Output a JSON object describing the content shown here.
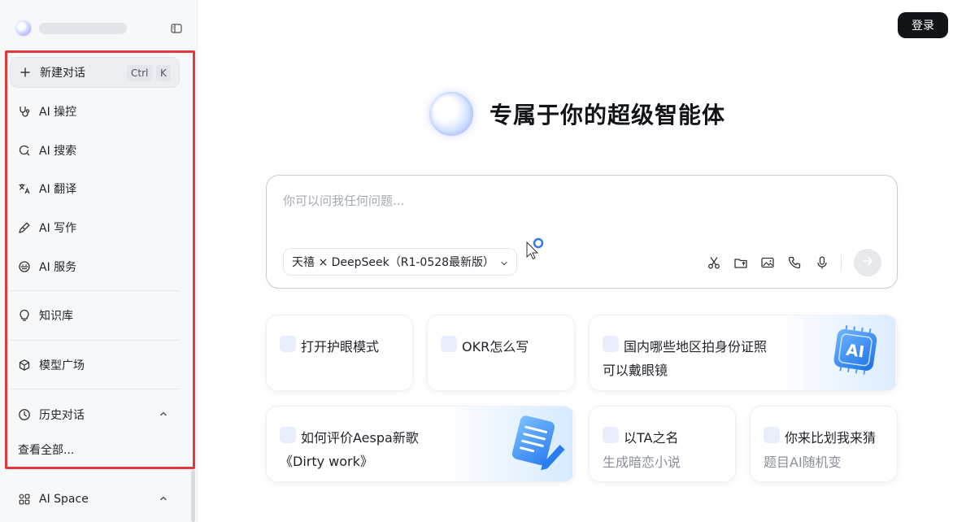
{
  "sidebar": {
    "collapse_icon": "sidebar-toggle-icon",
    "new_chat": {
      "label": "新建对话",
      "shortcut_ctrl": "Ctrl",
      "shortcut_key": "K"
    },
    "items": [
      {
        "label": "AI 操控",
        "icon": "stethoscope-icon"
      },
      {
        "label": "AI 搜索",
        "icon": "search-refresh-icon"
      },
      {
        "label": "AI 翻译",
        "icon": "translate-icon"
      },
      {
        "label": "AI 写作",
        "icon": "pen-icon"
      },
      {
        "label": "AI 服务",
        "icon": "service-icon"
      },
      {
        "label": "知识库",
        "icon": "lightbulb-icon"
      },
      {
        "label": "模型广场",
        "icon": "cube-icon"
      }
    ],
    "history": {
      "label": "历史对话",
      "see_all": "查看全部..."
    },
    "space": {
      "label": "AI Space"
    }
  },
  "header": {
    "login_label": "登录"
  },
  "hero": {
    "title": "专属于你的超级智能体"
  },
  "chat": {
    "placeholder": "你可以问我任何问题...",
    "model": "天禧 × DeepSeek（R1-0528最新版）"
  },
  "suggestions": [
    {
      "line1": "打开护眼模式"
    },
    {
      "line1": "OKR怎么写"
    },
    {
      "line1": "国内哪些地区拍身份证照",
      "line2": "可以戴眼镜"
    },
    {
      "line1": "如何评价Aespa新歌",
      "line2": "《Dirty work》"
    },
    {
      "line1": "以TA之名",
      "sub": "生成暗恋小说"
    },
    {
      "line1": "你来比划我来猜",
      "sub": "题目AI随机变"
    }
  ],
  "colors": {
    "highlight": "#e5383b",
    "accent": "#2f7cf6",
    "login_bg": "#111418"
  }
}
